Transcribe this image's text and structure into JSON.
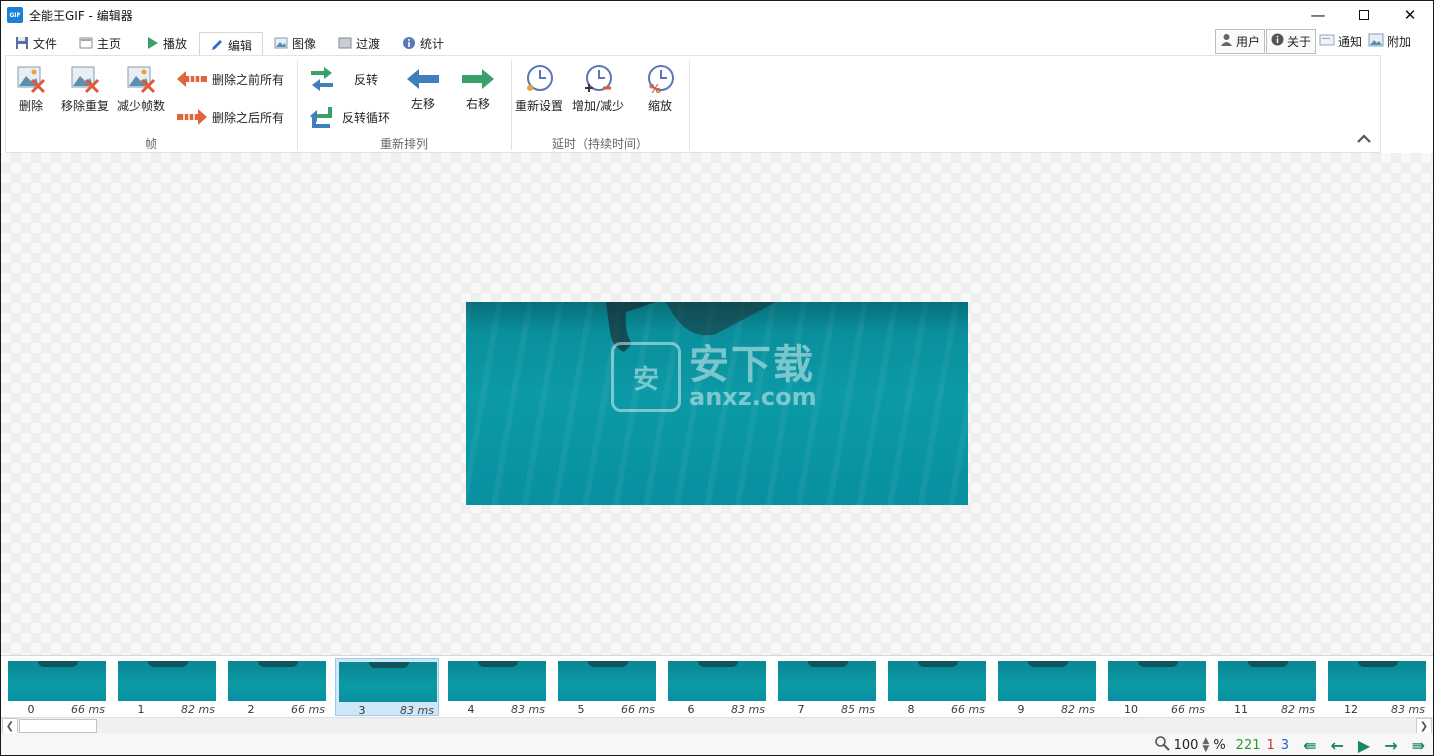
{
  "window": {
    "app_icon": "GIF",
    "title": "全能王GIF - 编辑器",
    "controls": [
      "minimize-icon",
      "maximize-icon",
      "close-icon"
    ]
  },
  "tabs": [
    {
      "label": "文件",
      "icon": "save-icon"
    },
    {
      "label": "主页",
      "icon": "home-icon"
    },
    {
      "label": "播放",
      "icon": "play-icon"
    },
    {
      "label": "编辑",
      "icon": "pencil-icon",
      "active": true
    },
    {
      "label": "图像",
      "icon": "image-icon"
    },
    {
      "label": "过渡",
      "icon": "transition-icon"
    },
    {
      "label": "统计",
      "icon": "info-icon"
    }
  ],
  "right_buttons": {
    "user": "用户",
    "about": "关于",
    "notify": "通知",
    "extras": "附加"
  },
  "ribbon": {
    "frames": {
      "title": "帧",
      "delete": "删除",
      "remove_duplicates": "移除重复",
      "reduce_frames": "减少帧数",
      "delete_before": "删除之前所有",
      "delete_after": "删除之后所有"
    },
    "reorder": {
      "title": "重新排列",
      "reverse": "反转",
      "yoyo": "反转循环",
      "move_left": "左移",
      "move_right": "右移"
    },
    "delay": {
      "title": "延时（持续时间）",
      "reset": "重新设置",
      "increase_decrease": "增加/减少",
      "scale": "缩放"
    }
  },
  "watermark": {
    "cn": "安下载",
    "en": "anxz.com",
    "badge": "安"
  },
  "frames": [
    {
      "index": "0",
      "delay": "66 ms"
    },
    {
      "index": "1",
      "delay": "82 ms"
    },
    {
      "index": "2",
      "delay": "66 ms"
    },
    {
      "index": "3",
      "delay": "83 ms",
      "selected": true
    },
    {
      "index": "4",
      "delay": "83 ms"
    },
    {
      "index": "5",
      "delay": "66 ms"
    },
    {
      "index": "6",
      "delay": "83 ms"
    },
    {
      "index": "7",
      "delay": "85 ms"
    },
    {
      "index": "8",
      "delay": "66 ms"
    },
    {
      "index": "9",
      "delay": "82 ms"
    },
    {
      "index": "10",
      "delay": "66 ms"
    },
    {
      "index": "11",
      "delay": "82 ms"
    },
    {
      "index": "12",
      "delay": "83 ms"
    }
  ],
  "status": {
    "zoom": "100",
    "zoom_unit": "%",
    "total_frames": "221",
    "selected_count": "1",
    "current_frame": "3",
    "colors": {
      "total": "#2e9a2e",
      "selected": "#d23030",
      "current": "#2a5fc7"
    }
  },
  "colors": {
    "accent": "#1e7fd6",
    "water": "#0b9aa6",
    "nav": "#1a8a5a"
  }
}
